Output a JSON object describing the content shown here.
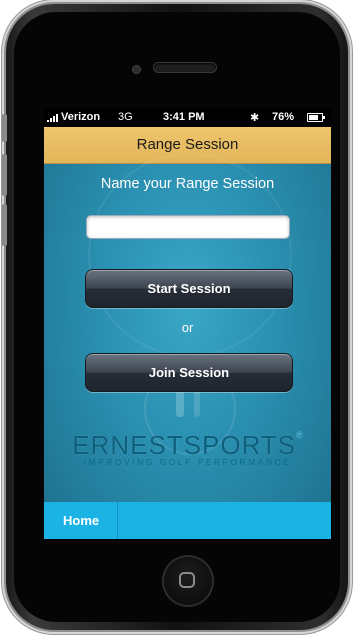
{
  "status_bar": {
    "carrier": "Verizon",
    "network": "3G",
    "time": "3:41 PM",
    "battery": "76%",
    "bluetooth_icon": "bluetooth-icon"
  },
  "header": {
    "title": "Range Session"
  },
  "form": {
    "prompt": "Name your Range Session",
    "name_value": "",
    "name_placeholder": ""
  },
  "buttons": {
    "start": "Start Session",
    "separator": "or",
    "join": "Join Session"
  },
  "logo": {
    "part1": "ERNEST",
    "part2": "SPORTS",
    "mark": "®",
    "tagline": "IMPROVING GOLF PERFORMANCE"
  },
  "tabbar": {
    "home": "Home"
  },
  "colors": {
    "header_bg": "#e5b75c",
    "background": "#2a8fb0",
    "tabbar_bg": "#1ab3e3",
    "button_dark": "#2b323c"
  }
}
